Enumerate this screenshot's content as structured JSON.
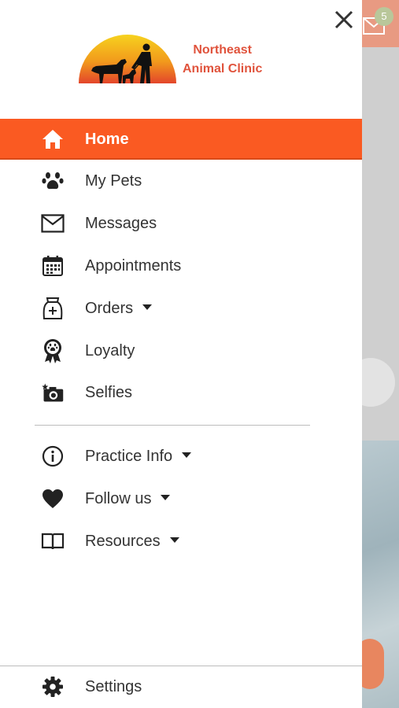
{
  "background": {
    "badge_count": "5"
  },
  "header": {
    "logo_line1": "Northeast",
    "logo_line2": "Animal Clinic"
  },
  "menu": {
    "items": [
      {
        "label": "Home",
        "icon": "home-icon",
        "active": true
      },
      {
        "label": "My Pets",
        "icon": "paw-icon"
      },
      {
        "label": "Messages",
        "icon": "mail-icon"
      },
      {
        "label": "Appointments",
        "icon": "calendar-icon"
      },
      {
        "label": "Orders",
        "icon": "pet-food-bag-icon",
        "expandable": true
      },
      {
        "label": "Loyalty",
        "icon": "award-ribbon-icon"
      },
      {
        "label": "Selfies",
        "icon": "camera-icon"
      }
    ],
    "secondary_items": [
      {
        "label": "Practice Info",
        "icon": "info-icon",
        "expandable": true
      },
      {
        "label": "Follow us",
        "icon": "heart-icon",
        "expandable": true
      },
      {
        "label": "Resources",
        "icon": "book-icon",
        "expandable": true
      }
    ],
    "settings_label": "Settings"
  },
  "colors": {
    "accent": "#fa5a22",
    "logo_text": "#e0533c"
  }
}
